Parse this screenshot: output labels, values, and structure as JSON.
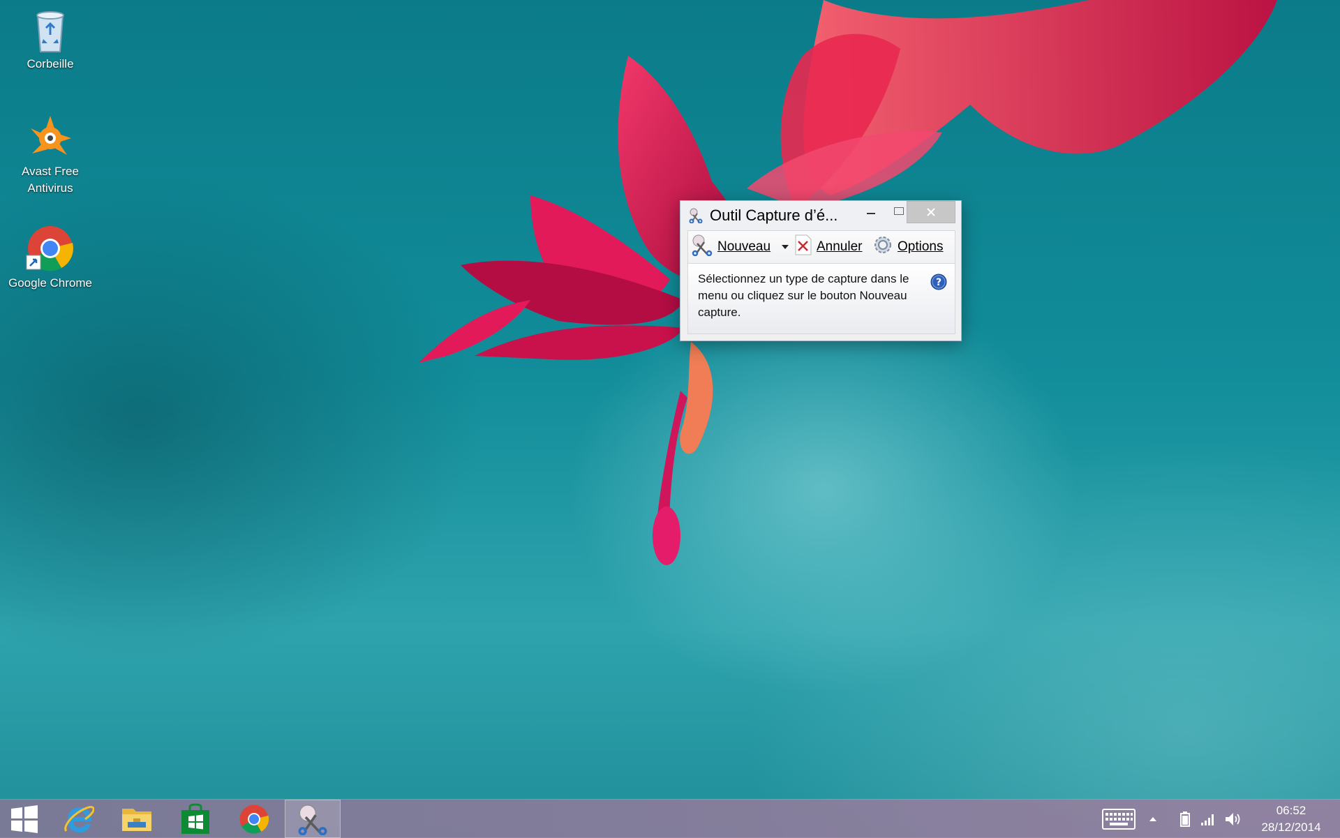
{
  "desktop": {
    "icons": [
      {
        "label": "Corbeille"
      },
      {
        "label": "Avast Free Antivirus"
      },
      {
        "label": "Google Chrome"
      }
    ]
  },
  "snipping_tool": {
    "title": "Outil Capture d’é...",
    "toolbar": {
      "new_label": "Nouveau",
      "cancel_label": "Annuler",
      "options_label": "Options"
    },
    "instructions": "Sélectionnez un type de capture dans le menu ou cliquez sur le bouton Nouveau capture."
  },
  "taskbar": {
    "pinned": [
      "start-button",
      "internet-explorer",
      "file-explorer",
      "windows-store",
      "google-chrome",
      "snipping-tool"
    ],
    "clock": {
      "time": "06:52",
      "date": "28/12/2014"
    }
  },
  "colors": {
    "wallpaper": "#128d9a",
    "flower": "#d8144f",
    "taskbar": "#8c7c9c",
    "window_frame": "#a8b6c6"
  }
}
